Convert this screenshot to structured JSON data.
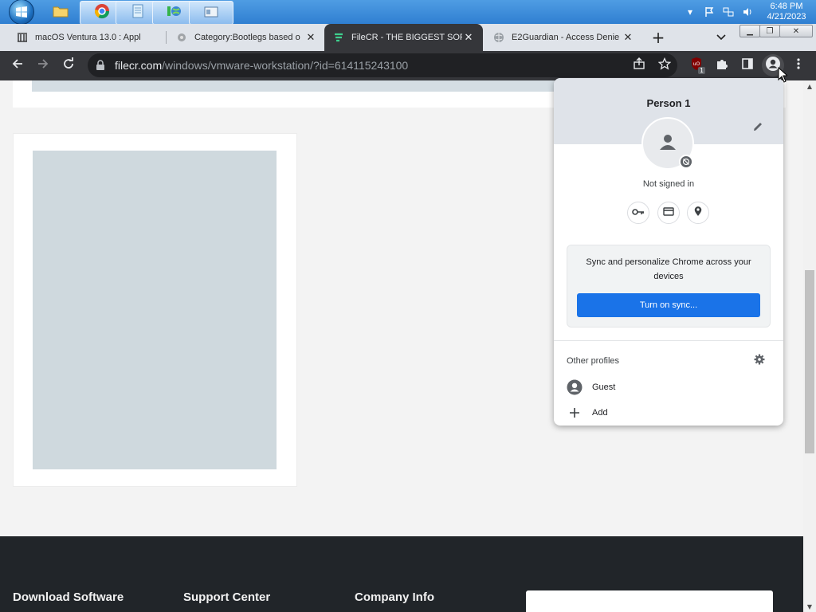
{
  "taskbar": {
    "clock_time": "6:48 PM",
    "clock_date": "4/21/2023"
  },
  "browser": {
    "tabs": [
      {
        "title": "macOS Ventura 13.0 : Appl",
        "favicon": "columns-icon"
      },
      {
        "title": "Category:Bootlegs based o",
        "favicon": "badge-icon"
      },
      {
        "title": "FileCR - THE BIGGEST SOF",
        "favicon": "filecr-icon"
      },
      {
        "title": "E2Guardian - Access Denie",
        "favicon": "globe-icon"
      }
    ],
    "url_host": "filecr.com",
    "url_path": "/windows/vmware-workstation/?id=614115243100",
    "extension_badge": "1"
  },
  "profile_menu": {
    "person_name": "Person 1",
    "status": "Not signed in",
    "sync_text": "Sync and personalize Chrome across your devices",
    "sync_button": "Turn on sync...",
    "other_profiles_label": "Other profiles",
    "guest_label": "Guest",
    "add_label": "Add"
  },
  "footer": {
    "col1": "Download Software",
    "col2": "Support Center",
    "col3": "Company Info"
  },
  "colors": {
    "sync_button": "#1a73e8",
    "toolbar": "#35363a",
    "footer": "#212529"
  }
}
